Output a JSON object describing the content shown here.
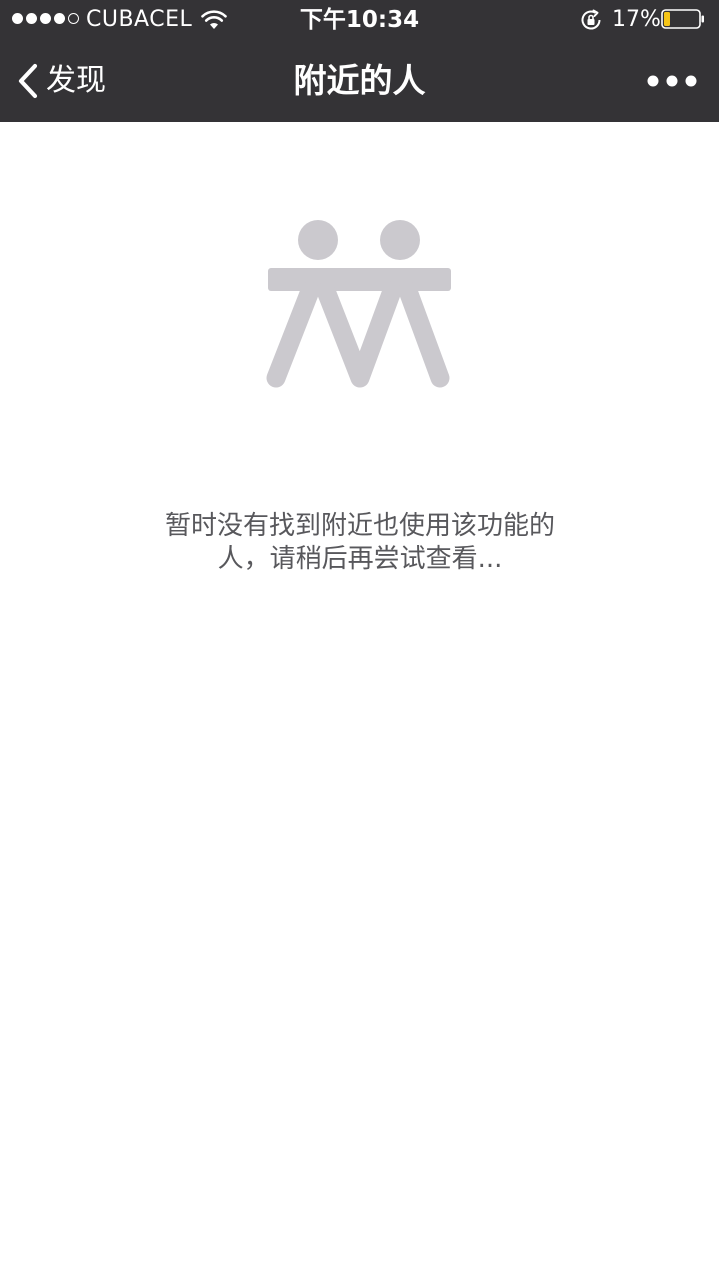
{
  "status_bar": {
    "signal_bars_filled": 4,
    "signal_bars_total": 5,
    "carrier": "CUBACEL",
    "time": "下午10:34",
    "battery_percent": "17%",
    "battery_level": 0.17,
    "icons": [
      "wifi-icon",
      "orientation-lock-icon",
      "battery-icon"
    ]
  },
  "nav": {
    "back_label": "发现",
    "title": "附近的人",
    "more_icon": "more-dots-icon"
  },
  "empty_state": {
    "illustration": "two-people-icon",
    "message_line1": "暂时没有找到附近也使用该功能的",
    "message_line2": "人，请稍后再尝试查看..."
  },
  "colors": {
    "header_background": "#343336",
    "illustration": "#cbc9ce",
    "message_text": "#58585c",
    "battery_fill": "#f5c518"
  }
}
